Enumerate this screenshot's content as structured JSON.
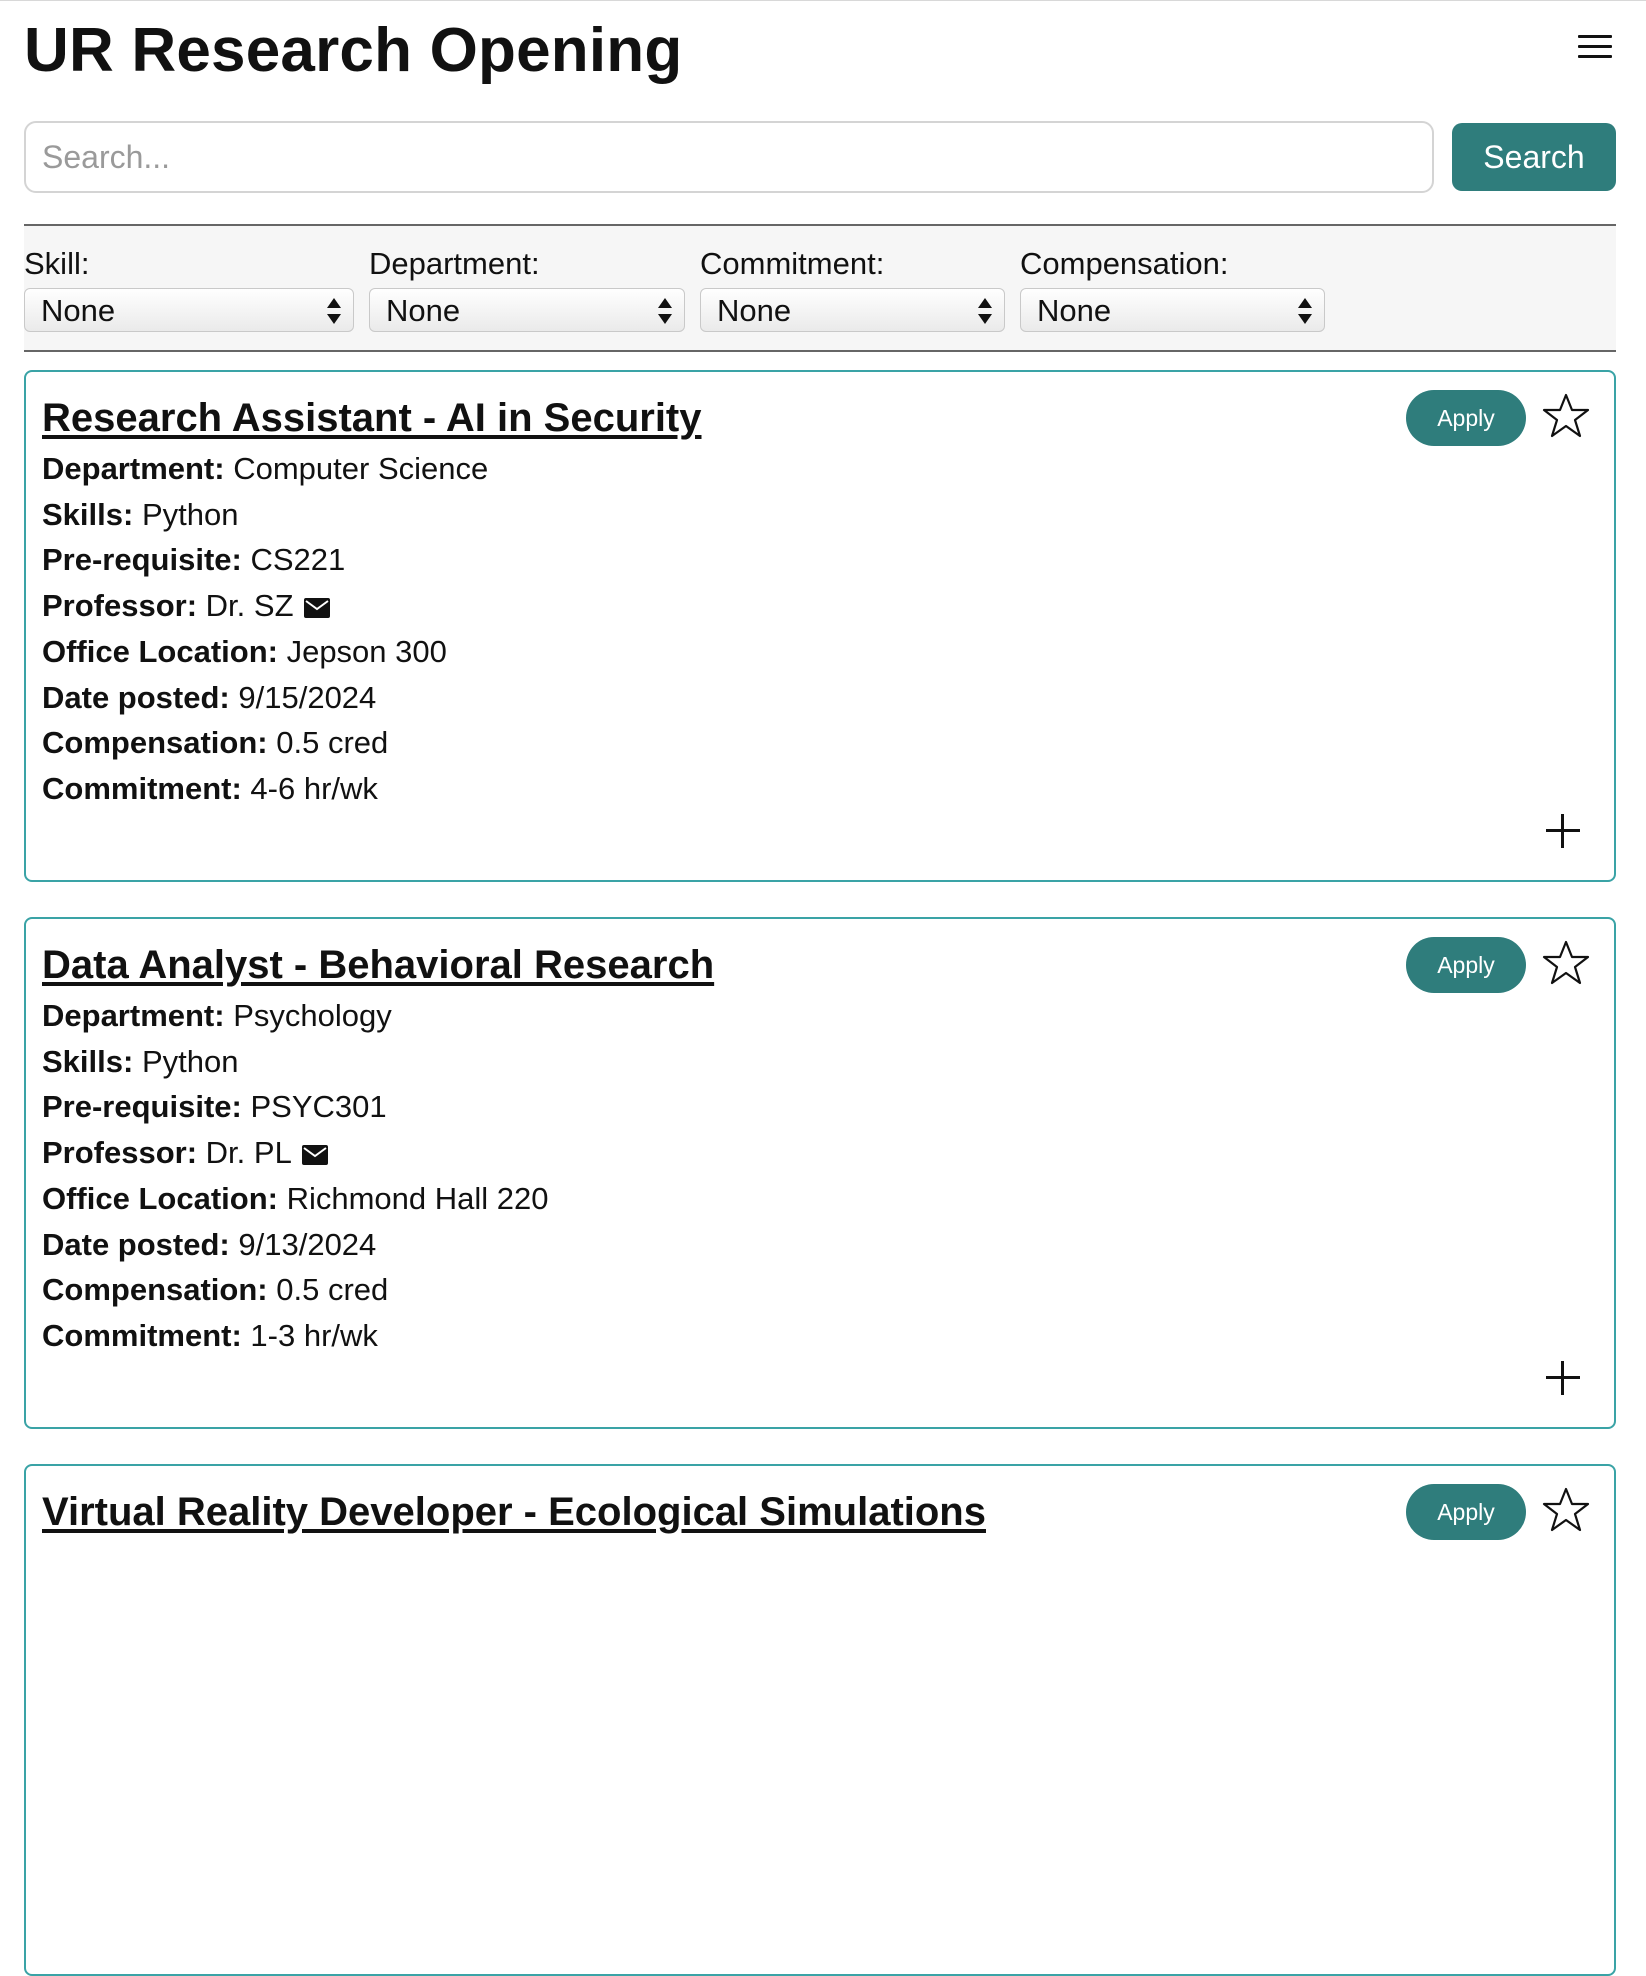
{
  "header": {
    "title": "UR Research Opening",
    "menu_icon": "hamburger-menu-icon"
  },
  "search": {
    "placeholder": "Search...",
    "value": "",
    "button_label": "Search"
  },
  "filters": [
    {
      "label": "Skill:",
      "selected": "None"
    },
    {
      "label": "Department:",
      "selected": "None"
    },
    {
      "label": "Commitment:",
      "selected": "None"
    },
    {
      "label": "Compensation:",
      "selected": "None"
    }
  ],
  "colors": {
    "accent": "#2f7d7c",
    "card_border": "#3aa3a6"
  },
  "labels": {
    "department": "Department:",
    "skills": "Skills:",
    "prerequisite": "Pre-requisite:",
    "professor": "Professor:",
    "office": "Office Location:",
    "date": "Date posted:",
    "compensation": "Compensation:",
    "commitment": "Commitment:",
    "apply": "Apply"
  },
  "listings": [
    {
      "title": "Research Assistant - AI in Security",
      "department": "Computer Science",
      "skills": "Python",
      "prerequisite": "CS221",
      "professor": "Dr. SZ",
      "office": "Jepson 300",
      "date": "9/15/2024",
      "compensation": "0.5 cred",
      "commitment": "4-6 hr/wk",
      "favorited": false
    },
    {
      "title": "Data Analyst - Behavioral Research",
      "department": "Psychology",
      "skills": "Python",
      "prerequisite": "PSYC301",
      "professor": "Dr. PL",
      "office": "Richmond Hall 220",
      "date": "9/13/2024",
      "compensation": "0.5 cred",
      "commitment": "1-3 hr/wk",
      "favorited": false
    },
    {
      "title": "Virtual Reality Developer - Ecological Simulations",
      "favorited": false
    }
  ]
}
